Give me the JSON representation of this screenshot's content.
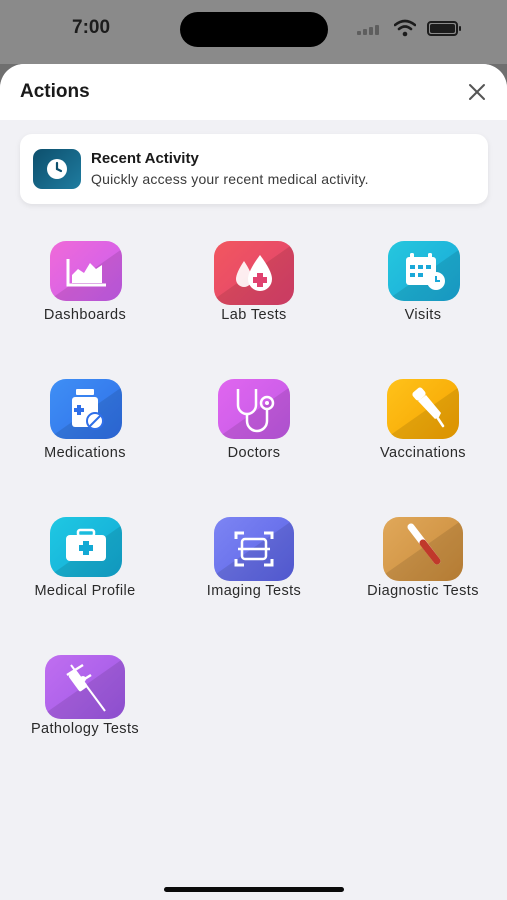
{
  "status_bar": {
    "time": "7:00"
  },
  "sheet": {
    "title": "Actions",
    "recent": {
      "title": "Recent Activity",
      "subtitle": "Quickly access your recent medical activity."
    },
    "tiles": [
      {
        "label": "Dashboards",
        "icon": "chart-icon",
        "color_a": "#f06ad8",
        "color_b": "#c95ef0"
      },
      {
        "label": "Lab Tests",
        "icon": "blood-drop-icon",
        "color_a": "#f2575f",
        "color_b": "#e0426f"
      },
      {
        "label": "Visits",
        "icon": "calendar-icon",
        "color_a": "#25c7de",
        "color_b": "#1aa8d8"
      },
      {
        "label": "Medications",
        "icon": "pill-bottle-icon",
        "color_a": "#3f8ff5",
        "color_b": "#2f6fe8"
      },
      {
        "label": "Doctors",
        "icon": "stethoscope-icon",
        "color_a": "#e066ef",
        "color_b": "#c25ae6"
      },
      {
        "label": "Vaccinations",
        "icon": "dropper-icon",
        "color_a": "#ffc21a",
        "color_b": "#f5a300"
      },
      {
        "label": "Medical Profile",
        "icon": "medical-kit-icon",
        "color_a": "#1fc8e3",
        "color_b": "#13a9d4"
      },
      {
        "label": "Imaging Tests",
        "icon": "scan-icon",
        "color_a": "#7d85f3",
        "color_b": "#5a62e6"
      },
      {
        "label": "Diagnostic Tests",
        "icon": "test-tube-icon",
        "color_a": "#e0a85a",
        "color_b": "#c98a3a"
      },
      {
        "label": "Pathology Tests",
        "icon": "syringe-icon",
        "color_a": "#c06ef0",
        "color_b": "#9d58e6"
      }
    ]
  }
}
